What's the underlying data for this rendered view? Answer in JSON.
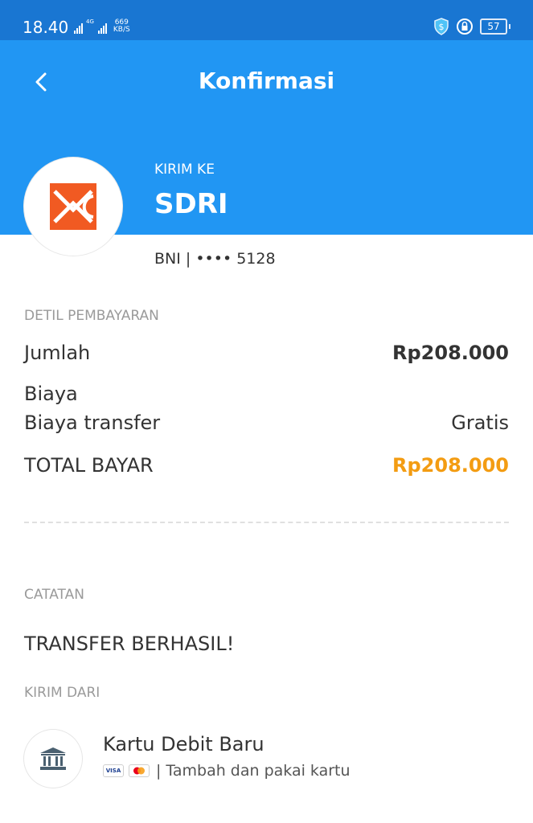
{
  "status_bar": {
    "time": "18.40",
    "network_tag": "4G",
    "speed_value": "669",
    "speed_unit": "KB/S",
    "battery": "57",
    "icons": [
      "signal-icon",
      "shield-dollar-icon",
      "rotation-lock-icon",
      "battery-icon"
    ]
  },
  "header": {
    "title": "Konfirmasi",
    "back_icon": "chevron-left-icon",
    "color": "#2196f3"
  },
  "recipient": {
    "label": "KIRIM KE",
    "name": "SDRI",
    "bank_account": "BNI | •••• 5128",
    "logo_icon": "bni-logo-icon",
    "logo_color": "#f15a22"
  },
  "payment": {
    "section_label": "DETIL PEMBAYARAN",
    "amount_label": "Jumlah",
    "amount_value": "Rp208.000",
    "fee_heading": "Biaya",
    "transfer_fee_label": "Biaya transfer",
    "transfer_fee_value": "Gratis",
    "total_label": "TOTAL BAYAR",
    "total_value": "Rp208.000",
    "total_color": "#f39c12"
  },
  "notes": {
    "section_label": "CATATAN",
    "text": "TRANSFER BERHASIL!"
  },
  "source": {
    "section_label": "KIRIM DARI",
    "icon": "bank-icon",
    "title": "Kartu Debit Baru",
    "visa_text": "VISA",
    "separator": "|",
    "subtitle": "Tambah dan pakai kartu"
  }
}
